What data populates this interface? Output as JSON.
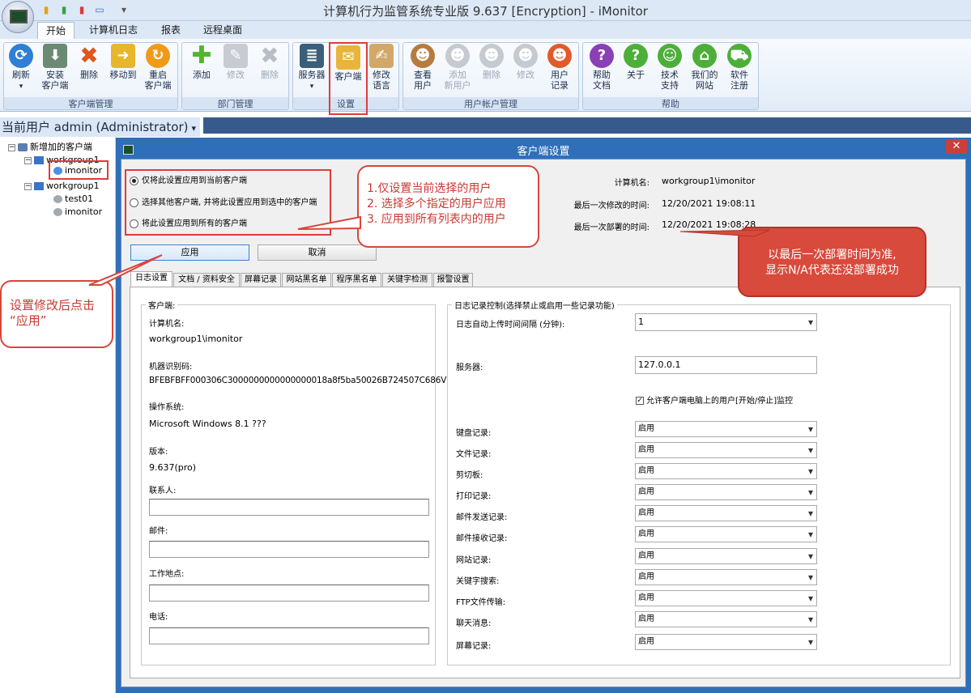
{
  "window": {
    "title": "计算机行为监管系统专业版 9.637 [Encryption] - iMonitor"
  },
  "ribbon_tabs": [
    "开始",
    "计算机日志",
    "报表",
    "远程桌面"
  ],
  "groups": {
    "client_mgmt": {
      "label": "客户端管理",
      "buttons": [
        "刷新",
        "安装\n客户端",
        "删除",
        "移动到",
        "重启\n客户端"
      ]
    },
    "dept_mgmt": {
      "label": "部门管理",
      "buttons": [
        "添加",
        "修改",
        "删除"
      ]
    },
    "settings": {
      "label": "设置",
      "buttons": [
        "服务器",
        "客户端",
        "修改\n语言"
      ]
    },
    "user_mgmt": {
      "label": "用户帐户管理",
      "buttons": [
        "查看\n用户",
        "添加\n新用户",
        "删除",
        "修改",
        "用户\n记录"
      ]
    },
    "help": {
      "label": "帮助",
      "buttons": [
        "帮助\n文档",
        "关于",
        "技术\n支持",
        "我们的\n网站",
        "软件\n注册"
      ]
    }
  },
  "current_user": "当前用户 admin (Administrator)",
  "tree": {
    "root": "新增加的客户端",
    "group1": "workgroup1",
    "g1_child": "imonitor",
    "group2": "workgroup1",
    "g2_children": [
      "test01",
      "imonitor"
    ]
  },
  "dialog": {
    "title": "客户端设置",
    "radios": [
      "仅将此设置应用到当前客户端",
      "选择其他客户端, 并将此设置应用到选中的客户端",
      "将此设置应用到所有的客户端"
    ],
    "apply": "应用",
    "cancel": "取消",
    "computer_name_label": "计算机名:",
    "computer_name": "workgroup1\\imonitor",
    "last_modified_label": "最后一次修改的时间:",
    "last_modified": "12/20/2021 19:08:11",
    "last_deployed_label": "最后一次部署的时间:",
    "last_deployed": "12/20/2021 19:08:28",
    "tabs": [
      "日志设置",
      "文档 / 资料安全",
      "屏幕记录",
      "网站黑名单",
      "程序黑名单",
      "关键字检测",
      "报警设置"
    ],
    "client": {
      "legend": "客户端:",
      "name_label": "计算机名:",
      "name": "workgroup1\\imonitor",
      "machine_id_label": "机器识别码:",
      "machine_id": "BFEBFBFF000306C3000000000000000018a8f5ba50026B724507C686V",
      "os_label": "操作系统:",
      "os": "Microsoft Windows 8.1 ???",
      "version_label": "版本:",
      "version": "9.637(pro)",
      "contact_label": "联系人:",
      "mail_label": "邮件:",
      "location_label": "工作地点:",
      "phone_label": "电话:"
    },
    "log_control": {
      "legend": "日志记录控制(选择禁止或启用一些记录功能)",
      "upload_interval_label": "日志自动上传时间间隔 (分钟):",
      "upload_interval": "1",
      "server_label": "服务器:",
      "server": "127.0.0.1",
      "allow_users": "允许客户端电脑上的用户[开始/停止]监控",
      "items": [
        {
          "label": "键盘记录:",
          "value": "启用"
        },
        {
          "label": "文件记录:",
          "value": "启用"
        },
        {
          "label": "剪切板:",
          "value": "启用"
        },
        {
          "label": "打印记录:",
          "value": "启用"
        },
        {
          "label": "邮件发送记录:",
          "value": "启用"
        },
        {
          "label": "邮件接收记录:",
          "value": "启用"
        },
        {
          "label": "网站记录:",
          "value": "启用"
        },
        {
          "label": "关键字搜索:",
          "value": "启用"
        },
        {
          "label": "FTP文件传输:",
          "value": "启用"
        },
        {
          "label": "聊天消息:",
          "value": "启用"
        },
        {
          "label": "屏幕记录:",
          "value": "启用"
        }
      ]
    }
  },
  "callouts": {
    "apply_options": [
      "1.仅设置当前选择的用户",
      "2. 选择多个指定的用户应用",
      "3. 应用到所有列表内的用户"
    ],
    "deploy_note": [
      "以最后一次部署时间为准,",
      "显示N/A代表还没部署成功"
    ],
    "apply_hint": [
      "设置修改后点击",
      "“应用”"
    ]
  }
}
